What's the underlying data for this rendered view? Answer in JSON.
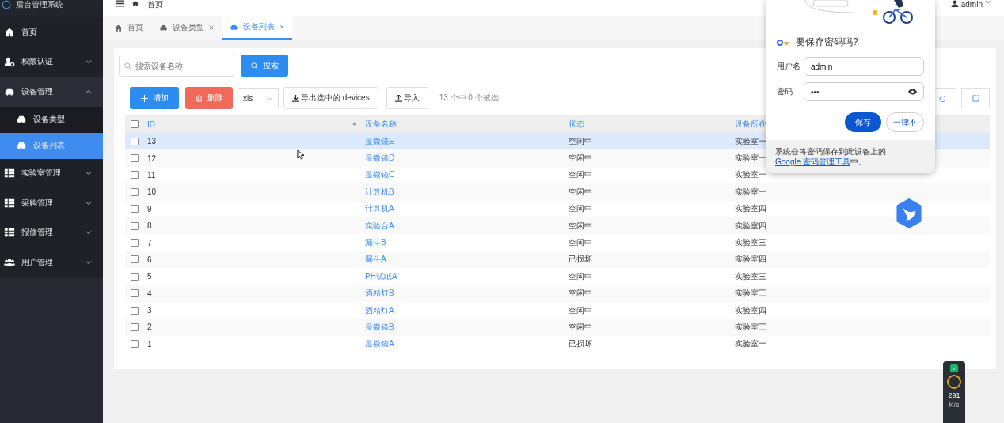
{
  "app": {
    "title": "后台管理系统"
  },
  "header": {
    "breadcrumb": "首页",
    "user": "admin"
  },
  "sidebar": {
    "items": [
      {
        "label": "首页"
      },
      {
        "label": "权限认证",
        "expanded": false
      },
      {
        "label": "设备管理",
        "expanded": true,
        "children": [
          {
            "label": "设备类型",
            "selected": false
          },
          {
            "label": "设备列表",
            "selected": true
          }
        ]
      },
      {
        "label": "实验室管理",
        "expanded": false
      },
      {
        "label": "采购管理",
        "expanded": false
      },
      {
        "label": "报修管理",
        "expanded": false
      },
      {
        "label": "用户管理",
        "expanded": false
      }
    ]
  },
  "tabs": [
    {
      "label": "首页",
      "closable": false,
      "selected": false
    },
    {
      "label": "设备类型",
      "closable": true,
      "selected": false
    },
    {
      "label": "设备列表",
      "closable": true,
      "selected": true
    }
  ],
  "search": {
    "placeholder": "搜索设备名称",
    "button": "搜索"
  },
  "toolbar": {
    "add": "增加",
    "delete": "删除",
    "format": "xls",
    "export": "导出选中的 devices",
    "import": "导入",
    "selection": "13 个中 0 个被选"
  },
  "table": {
    "all_checked": false,
    "columns": [
      "ID",
      "设备名称",
      "状态",
      "设备所在"
    ],
    "rows": [
      {
        "checked": false,
        "highlighted": true,
        "cells": [
          "13",
          "显微镜E",
          "空闲中",
          "实验室一"
        ]
      },
      {
        "checked": false,
        "highlighted": false,
        "cells": [
          "12",
          "显微镜D",
          "空闲中",
          "实验室一"
        ]
      },
      {
        "checked": false,
        "highlighted": false,
        "cells": [
          "11",
          "显微镜C",
          "空闲中",
          "实验室一"
        ]
      },
      {
        "checked": false,
        "highlighted": false,
        "cells": [
          "10",
          "计算机B",
          "空闲中",
          "实验室一"
        ]
      },
      {
        "checked": false,
        "highlighted": false,
        "cells": [
          "9",
          "计算机A",
          "空闲中",
          "实验室四"
        ]
      },
      {
        "checked": false,
        "highlighted": false,
        "cells": [
          "8",
          "实验台A",
          "空闲中",
          "实验室四"
        ]
      },
      {
        "checked": false,
        "highlighted": false,
        "cells": [
          "7",
          "漏斗B",
          "空闲中",
          "实验室三"
        ]
      },
      {
        "checked": false,
        "highlighted": false,
        "cells": [
          "6",
          "漏斗A",
          "已损坏",
          "实验室四"
        ]
      },
      {
        "checked": false,
        "highlighted": false,
        "cells": [
          "5",
          "PH试纸A",
          "空闲中",
          "实验室三"
        ]
      },
      {
        "checked": false,
        "highlighted": false,
        "cells": [
          "4",
          "酒精灯B",
          "空闲中",
          "实验室三"
        ]
      },
      {
        "checked": false,
        "highlighted": false,
        "cells": [
          "3",
          "酒精灯A",
          "空闲中",
          "实验室四"
        ]
      },
      {
        "checked": false,
        "highlighted": false,
        "cells": [
          "2",
          "显微镜B",
          "空闲中",
          "实验室三"
        ]
      },
      {
        "checked": false,
        "highlighted": false,
        "cells": [
          "1",
          "显微镜A",
          "已损坏",
          "实验室一"
        ]
      }
    ]
  },
  "password_dialog": {
    "title": "要保存密码吗?",
    "username_label": "用户名",
    "username": "admin",
    "password_label": "密码",
    "password": "•••",
    "save": "保存",
    "never": "一律不",
    "note": "系统会将密码保存到此设备上的 ",
    "note_link": "Google 密码管理工具",
    "note_end": "中。"
  },
  "monitor": {
    "speed": "291",
    "unit": "K/s"
  }
}
